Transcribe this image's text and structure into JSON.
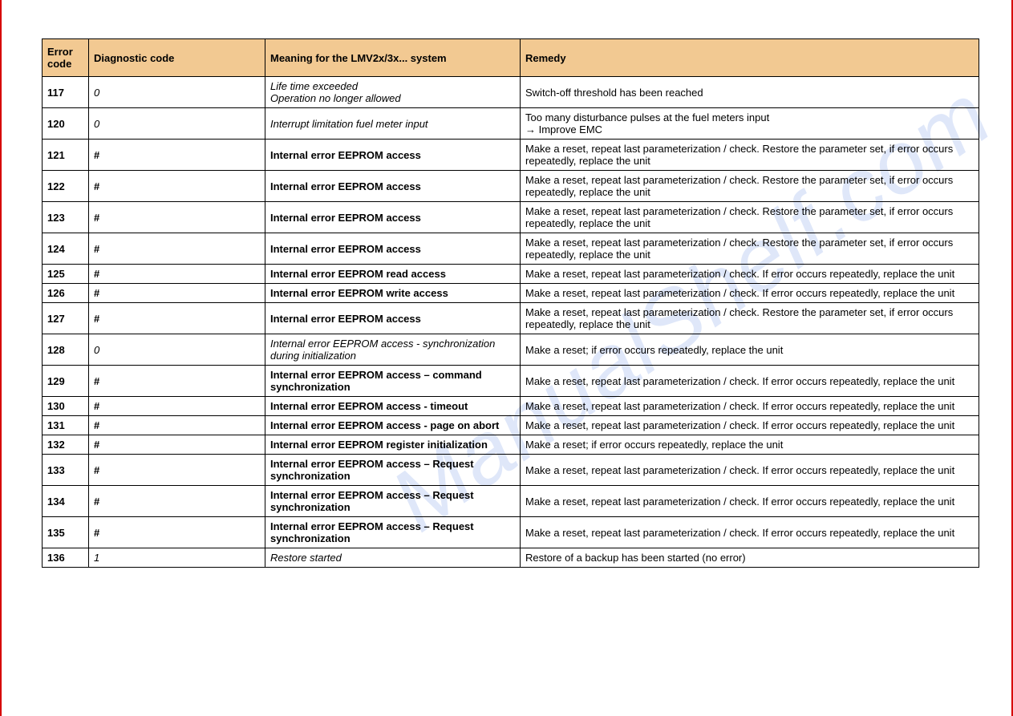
{
  "watermark": "ManualShelf.com",
  "table": {
    "headers": {
      "error_code": "Error code",
      "diagnostic_code": "Diagnostic code",
      "meaning": "Meaning for the LMV2x/3x... system",
      "remedy": "Remedy"
    },
    "rows": [
      {
        "code": "117",
        "diag": "0",
        "diag_style": "italic",
        "meaning": "Life time exceeded",
        "meaning2": "Operation no longer allowed",
        "meaning_style": "italic",
        "remedy": "Switch-off threshold has been reached"
      },
      {
        "code": "120",
        "diag": "0",
        "diag_style": "italic",
        "meaning": "Interrupt limitation fuel meter input",
        "meaning_style": "italic",
        "remedy": "Too many disturbance pulses at the fuel meters input",
        "remedy2": "→ Improve EMC"
      },
      {
        "code": "121",
        "diag": "#",
        "diag_style": "bold",
        "meaning": "Internal error EEPROM access",
        "meaning_style": "bold",
        "remedy": "Make a reset, repeat last parameterization / check. Restore the parameter set, if error occurs repeatedly, replace the unit"
      },
      {
        "code": "122",
        "diag": "#",
        "diag_style": "bold",
        "meaning": "Internal error EEPROM access",
        "meaning_style": "bold",
        "remedy": "Make a reset, repeat last parameterization / check. Restore the parameter set, if error occurs repeatedly, replace the unit"
      },
      {
        "code": "123",
        "diag": "#",
        "diag_style": "bold",
        "meaning": "Internal error EEPROM access",
        "meaning_style": "bold",
        "remedy": "Make a reset, repeat last parameterization / check. Restore the parameter set, if error occurs repeatedly, replace the unit"
      },
      {
        "code": "124",
        "diag": "#",
        "diag_style": "bold",
        "meaning": "Internal error EEPROM access",
        "meaning_style": "bold",
        "remedy": "Make a reset, repeat last parameterization / check. Restore the parameter set, if error occurs repeatedly, replace the unit"
      },
      {
        "code": "125",
        "diag": "#",
        "diag_style": "bold",
        "meaning": "Internal error EEPROM read access",
        "meaning_style": "bold",
        "remedy": "Make a reset, repeat last parameterization / check. If error occurs repeatedly, replace the unit"
      },
      {
        "code": "126",
        "diag": "#",
        "diag_style": "bold",
        "meaning": "Internal error EEPROM write access",
        "meaning_style": "bold",
        "remedy": "Make a reset, repeat last parameterization / check. If error occurs repeatedly, replace the unit"
      },
      {
        "code": "127",
        "diag": "#",
        "diag_style": "bold",
        "meaning": "Internal error EEPROM access",
        "meaning_style": "bold",
        "remedy": "Make a reset, repeat last parameterization / check. Restore the parameter set, if error occurs repeatedly, replace the unit"
      },
      {
        "code": "128",
        "diag": "0",
        "diag_style": "italic",
        "meaning": "Internal error EEPROM access - synchronization during initialization",
        "meaning_style": "italic",
        "remedy": "Make a reset; if error occurs repeatedly, replace the unit"
      },
      {
        "code": "129",
        "diag": "#",
        "diag_style": "bold",
        "meaning": "Internal error EEPROM access – command synchronization",
        "meaning_style": "bold",
        "remedy": "Make a reset, repeat last parameterization / check. If error occurs repeatedly, replace the unit"
      },
      {
        "code": "130",
        "diag": "#",
        "diag_style": "bold",
        "meaning": "Internal error EEPROM access - timeout",
        "meaning_style": "bold",
        "remedy": "Make a reset, repeat last parameterization / check. If error occurs repeatedly, replace the unit"
      },
      {
        "code": "131",
        "diag": "#",
        "diag_style": "bold",
        "meaning": "Internal error EEPROM access - page on abort",
        "meaning_style": "bold",
        "remedy": "Make a reset, repeat last parameterization / check. If error occurs repeatedly, replace the unit"
      },
      {
        "code": "132",
        "diag": "#",
        "diag_style": "bold",
        "meaning": "Internal error EEPROM register initialization",
        "meaning_style": "bold",
        "remedy": "Make a reset; if error occurs repeatedly, replace the unit"
      },
      {
        "code": "133",
        "diag": "#",
        "diag_style": "bold",
        "meaning": "Internal error EEPROM access – Request synchronization",
        "meaning_style": "bold",
        "remedy": "Make a reset, repeat last parameterization / check. If error occurs repeatedly, replace the unit"
      },
      {
        "code": "134",
        "diag": "#",
        "diag_style": "bold",
        "meaning": "Internal error EEPROM access – Request synchronization",
        "meaning_style": "bold",
        "remedy": "Make a reset, repeat last parameterization / check. If error occurs repeatedly, replace the unit"
      },
      {
        "code": "135",
        "diag": "#",
        "diag_style": "bold",
        "meaning": "Internal error EEPROM access – Request synchronization",
        "meaning_style": "bold",
        "remedy": "Make a reset, repeat last parameterization / check. If error occurs repeatedly, replace the unit"
      },
      {
        "code": "136",
        "diag": "1",
        "diag_style": "italic",
        "meaning": "Restore started",
        "meaning_style": "italic",
        "remedy": "Restore of a backup has been started (no error)"
      }
    ]
  }
}
